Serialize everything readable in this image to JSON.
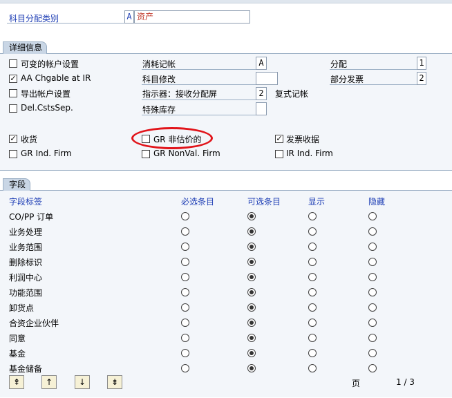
{
  "header": {
    "account_category_label": "科目分配类别",
    "account_category_key": "A",
    "account_category_value": "资产"
  },
  "details": {
    "tab_label": "详细信息",
    "checkboxes_left": [
      {
        "label": "可变的帐户设置",
        "checked": false
      },
      {
        "label": "AA Chgable at IR",
        "checked": true
      },
      {
        "label": "导出帐户设置",
        "checked": false
      },
      {
        "label": "Del.CstsSep.",
        "checked": false
      }
    ],
    "mid_fields": [
      {
        "label": "消耗记帐",
        "value": "A"
      },
      {
        "label": "科目修改",
        "value": ""
      },
      {
        "label": "指示器：接收分配屏",
        "value": "2"
      },
      {
        "label": "特殊库存",
        "value": ""
      }
    ],
    "double_entry_label": "复式记帐",
    "right_fields": [
      {
        "label": "分配",
        "value": "1"
      },
      {
        "label": "部分发票",
        "value": "2"
      }
    ],
    "gr_row": [
      {
        "label": "收货",
        "checked": true
      },
      {
        "label": "GR 非估价的",
        "checked": false
      },
      {
        "label": "发票收据",
        "checked": true
      }
    ],
    "firm_row": [
      {
        "label": "GR Ind. Firm",
        "checked": false
      },
      {
        "label": "GR NonVal. Firm",
        "checked": false
      },
      {
        "label": "IR Ind. Firm",
        "checked": false
      }
    ]
  },
  "fields": {
    "tab_label": "字段",
    "columns": [
      "字段标签",
      "必选条目",
      "可选条目",
      "显示",
      "隐藏"
    ],
    "rows": [
      {
        "label": "CO/PP 订单",
        "selected": 1
      },
      {
        "label": "业务处理",
        "selected": 1
      },
      {
        "label": "业务范围",
        "selected": 1
      },
      {
        "label": "删除标识",
        "selected": 1
      },
      {
        "label": "利润中心",
        "selected": 1
      },
      {
        "label": "功能范围",
        "selected": 1
      },
      {
        "label": "卸货点",
        "selected": 1
      },
      {
        "label": "合资企业伙伴",
        "selected": 1
      },
      {
        "label": "同意",
        "selected": 1
      },
      {
        "label": "基金",
        "selected": 1
      },
      {
        "label": "基金储备",
        "selected": 1
      }
    ]
  },
  "pager": {
    "page_label": "页",
    "page_value": "1 / 3",
    "buttons": [
      "first-page-icon",
      "previous-page-icon",
      "next-page-icon",
      "last-page-icon"
    ]
  },
  "colors": {
    "label_blue": "#1f3fb5",
    "value_red": "#c0392b",
    "highlight_ellipse": "#e1141a"
  }
}
